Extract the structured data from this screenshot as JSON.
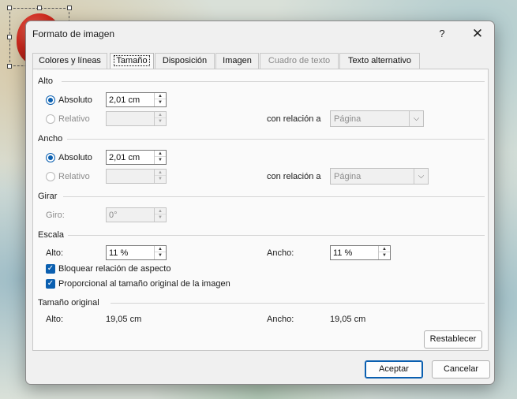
{
  "dialog": {
    "title": "Formato de imagen",
    "help_label": "?",
    "close_label": "✕"
  },
  "tabs": [
    {
      "label": "Colores y líneas",
      "state": "normal"
    },
    {
      "label": "Tamaño",
      "state": "active"
    },
    {
      "label": "Disposición",
      "state": "normal"
    },
    {
      "label": "Imagen",
      "state": "normal"
    },
    {
      "label": "Cuadro de texto",
      "state": "disabled"
    },
    {
      "label": "Texto alternativo",
      "state": "normal"
    }
  ],
  "alto": {
    "section_label": "Alto",
    "absoluto_label": "Absoluto",
    "absoluto_value": "2,01 cm",
    "relativo_label": "Relativo",
    "relativo_value": "",
    "relation_label": "con relación a",
    "relation_value": "Página"
  },
  "ancho": {
    "section_label": "Ancho",
    "absoluto_label": "Absoluto",
    "absoluto_value": "2,01 cm",
    "relativo_label": "Relativo",
    "relativo_value": "",
    "relation_label": "con relación a",
    "relation_value": "Página"
  },
  "girar": {
    "section_label": "Girar",
    "giro_label": "Giro:",
    "giro_value": "0°"
  },
  "escala": {
    "section_label": "Escala",
    "alto_label": "Alto:",
    "alto_value": "11 %",
    "ancho_label": "Ancho:",
    "ancho_value": "11 %",
    "lock_aspect_label": "Bloquear relación de aspecto",
    "lock_aspect_checked": true,
    "relative_original_label": "Proporcional al tamaño original de la imagen",
    "relative_original_checked": true
  },
  "tamano_original": {
    "section_label": "Tamaño original",
    "alto_label": "Alto:",
    "alto_value": "19,05 cm",
    "ancho_label": "Ancho:",
    "ancho_value": "19,05 cm"
  },
  "buttons": {
    "reset_label": "Restablecer",
    "ok_label": "Aceptar",
    "cancel_label": "Cancelar"
  },
  "colors": {
    "accent": "#0a5fb0"
  }
}
